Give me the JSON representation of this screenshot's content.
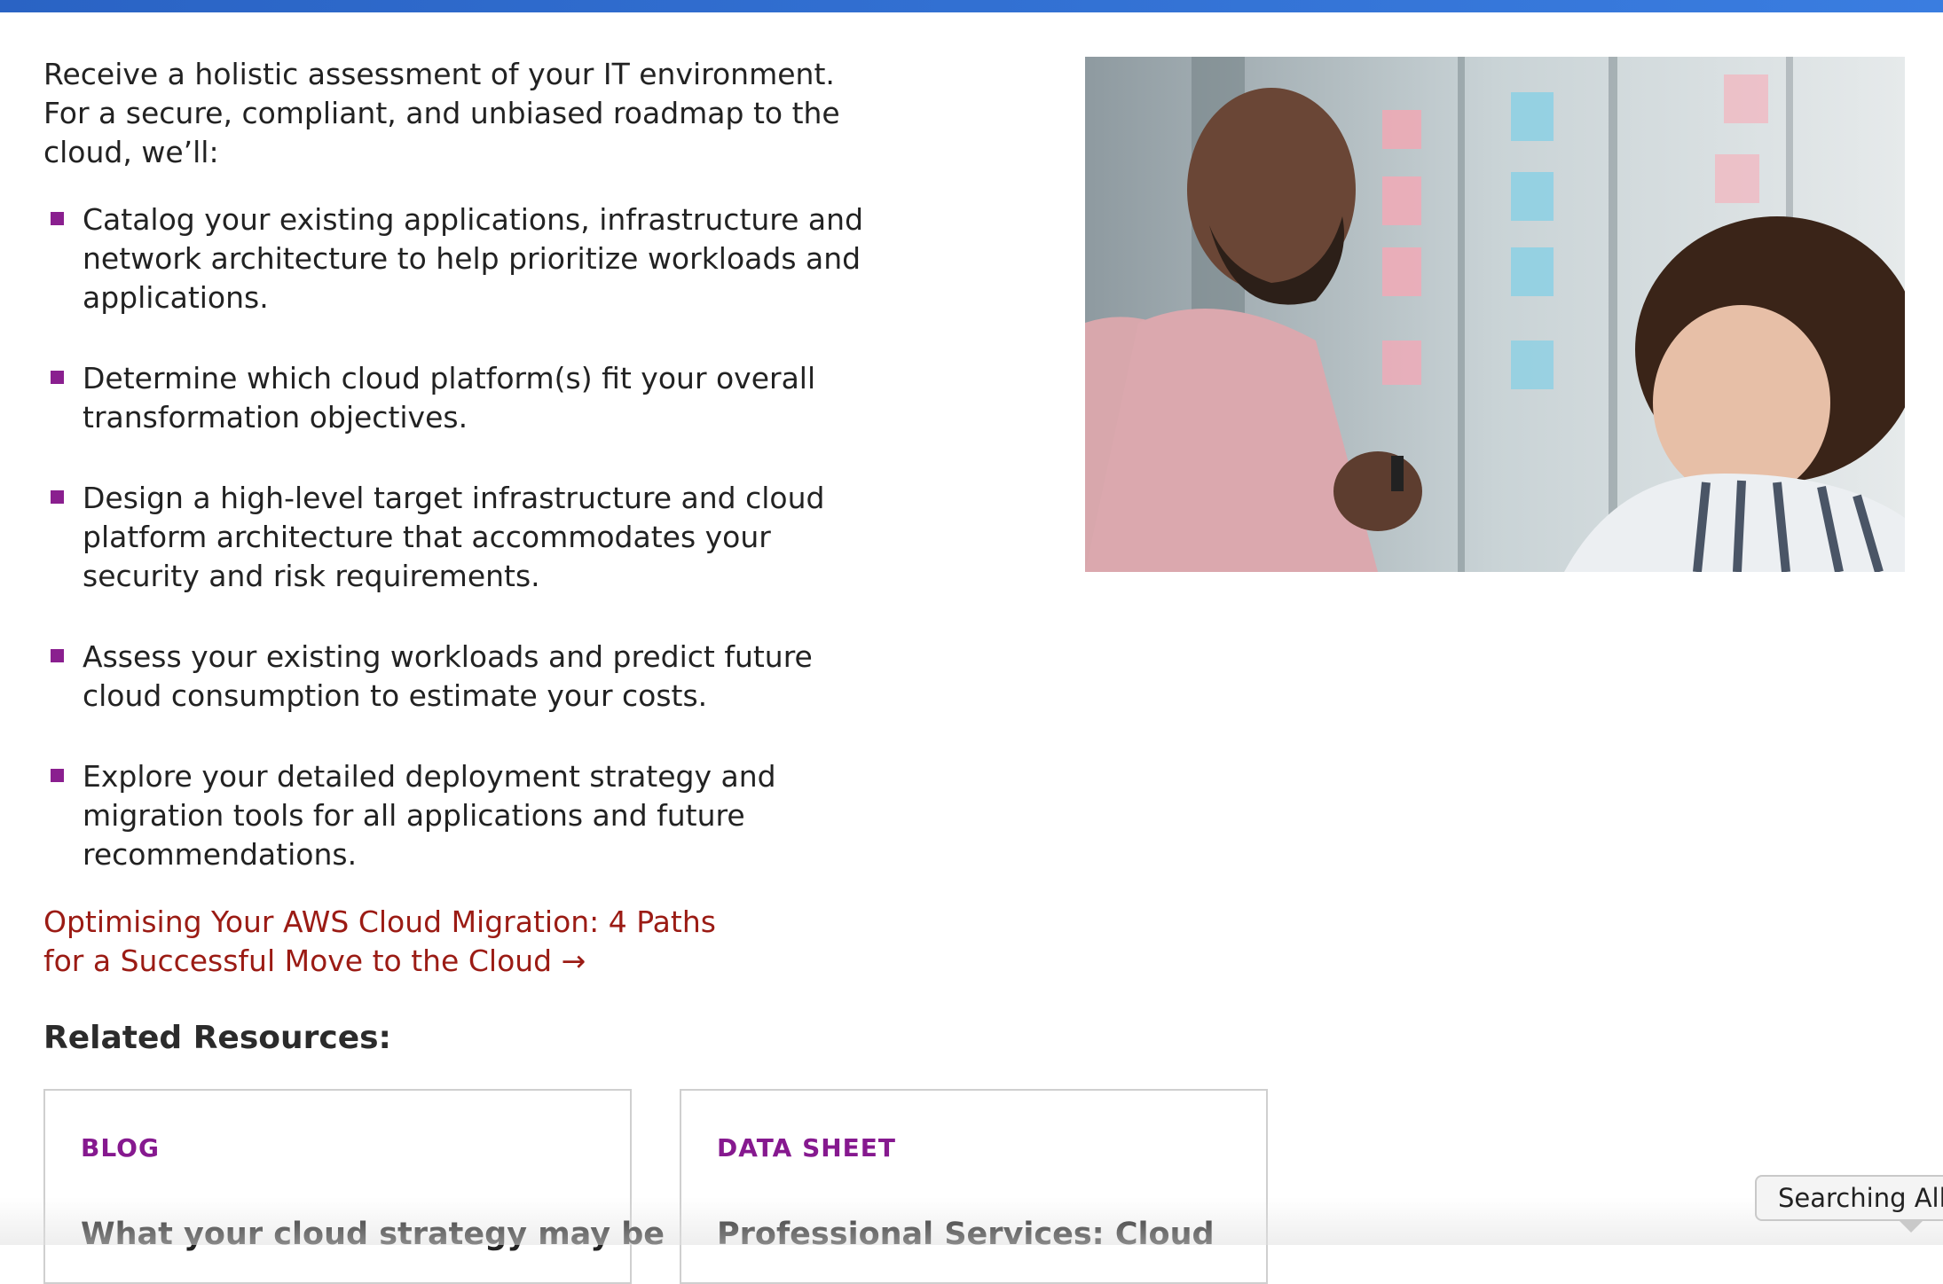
{
  "intro": "Receive a holistic assessment of your IT environment. For a secure, compliant, and unbiased roadmap to the cloud, we’ll:",
  "bullets": [
    "Catalog your existing applications, infrastructure and network architecture to help prioritize workloads and applications.",
    "Determine which cloud platform(s) fit your overall transformation objectives.",
    "Design a high-level target infrastructure and cloud platform architecture that accommodates your security and risk requirements.",
    "Assess your existing workloads and predict future cloud consumption to estimate your costs.",
    "Explore your detailed deployment strategy and migration tools for all applications and future recommendations."
  ],
  "cta_link": "Optimising Your AWS Cloud Migration: 4 Paths for a Successful Move to the Cloud →",
  "related": {
    "title": "Related Resources:",
    "cards": [
      {
        "tag": "BLOG",
        "title": "What your cloud strategy may be"
      },
      {
        "tag": "DATA SHEET",
        "title": "Professional Services: Cloud"
      }
    ]
  },
  "search_status": "Searching All M",
  "colors": {
    "top_bar": "#2a63c4",
    "bullet": "#8a1f8f",
    "link": "#9b1b14",
    "tag": "#86198f"
  }
}
